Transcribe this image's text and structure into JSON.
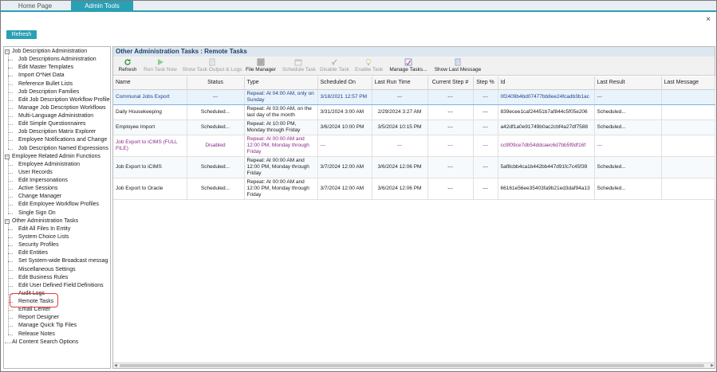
{
  "tabs": {
    "home": "Home Page",
    "admin": "Admin Tools"
  },
  "close_glyph": "×",
  "refresh_button": "Refresh",
  "sidebar": {
    "groups": [
      {
        "label": "Job Description Administration",
        "items": [
          "Job Descriptions Administration",
          "Edit Master Templates",
          "Import O*Net Data",
          "Reference Bullet Lists",
          "Job Description Families",
          "Edit Job Description Workflow Profile",
          "Manage Job Description Workflows",
          "Multi-Language Administration",
          "Edit Simple Questionnaires",
          "Job Description Matrix Explorer",
          "Employee Notifications and Change",
          "Job Description Named Expressions"
        ]
      },
      {
        "label": "Employee Related Admin Functions",
        "items": [
          "Employee Administration",
          "User Records",
          "Edit Impersonations",
          "Active Sessions",
          "Change Manager",
          "Edit Employee Workflow Profiles",
          "Single Sign On"
        ]
      },
      {
        "label": "Other Administration Tasks",
        "items": [
          "Edit All Files In Entity",
          "System Choice Lists",
          "Security Profiles",
          "Edit Entities",
          "Set System-wide Broadcast messag",
          "Miscellaneous Settings",
          "Edit Business Rules",
          "Edit User Defined Field Definitions",
          "Audit Logs",
          "Remote Tasks",
          "Email Center",
          "Report Designer",
          "Manage Quick Tip Files",
          "Release Notes"
        ]
      }
    ],
    "last_item": "AI Content Search Options"
  },
  "panel_title": "Other Administration Tasks : Remote Tasks",
  "toolbar": [
    {
      "label": "Refresh",
      "icon": "refresh-icon",
      "enabled": true
    },
    {
      "label": "Run Task Now",
      "icon": "play-icon",
      "enabled": false
    },
    {
      "label": "Show Task Output & Logs",
      "icon": "document-icon",
      "enabled": false
    },
    {
      "label": "File Manager",
      "icon": "file-manager-icon",
      "enabled": true
    },
    {
      "label": "Schedule Task",
      "icon": "calendar-icon",
      "enabled": false
    },
    {
      "label": "Disable Task",
      "icon": "disable-icon",
      "enabled": false
    },
    {
      "label": "Enable Task",
      "icon": "bulb-icon",
      "enabled": false
    },
    {
      "label": "Manage Tasks...",
      "icon": "manage-tasks-icon",
      "enabled": true
    },
    {
      "label": "Show Last Message",
      "icon": "message-icon",
      "enabled": true
    }
  ],
  "columns": [
    "Name",
    "Status",
    "Type",
    "Scheduled On",
    "Last Run Time",
    "Current Step #",
    "Step %",
    "Id",
    "Last Result",
    "Last Message"
  ],
  "rows": [
    {
      "name": "Communal Jobs Export",
      "status": "---",
      "type": "Repeat: At 04:00 AM, only on Sunday",
      "scheduled_on": "3/18/2021 12:57 PM",
      "last_run": "---",
      "step": "---",
      "pct": "---",
      "id": "0f2409b4bd07477bb8ee24fcadb3b1ac",
      "result": "---",
      "message": ""
    },
    {
      "name": "Daily Housekeeping",
      "status": "Scheduled...",
      "type": "Repeat: At 03:00 AM, on the last day of the month",
      "scheduled_on": "3/31/2024 3:00 AM",
      "last_run": "2/29/2024 3:27 AM",
      "step": "---",
      "pct": "---",
      "id": "839ecee1caf24451b7af844c5f05e206",
      "result": "Scheduled...",
      "message": ""
    },
    {
      "name": "Employee Import",
      "status": "Scheduled...",
      "type": "Repeat: At 10:00 PM, Monday through Friday",
      "scheduled_on": "3/6/2024 10:00 PM",
      "last_run": "3/5/2024 10:15 PM",
      "step": "---",
      "pct": "---",
      "id": "a42df1a0e91749b0ac2cbf4a27df7588",
      "result": "Scheduled...",
      "message": ""
    },
    {
      "name": "Job Export to iCIMS (FULL FILE)",
      "status": "Disabled",
      "type": "Repeat: At 00:00 AM and 12:00 PM, Monday through Friday",
      "scheduled_on": "---",
      "last_run": "---",
      "step": "---",
      "pct": "---",
      "id": "cc9f09ce7db54ddcaec6d7bb5f9df16f",
      "result": "---",
      "message": ""
    },
    {
      "name": "Job Export to iCIMS",
      "status": "Scheduled...",
      "type": "Repeat: At 00:00 AM and 12:00 PM, Monday through Friday",
      "scheduled_on": "3/7/2024 12:00 AM",
      "last_run": "3/6/2024 12:06 PM",
      "step": "---",
      "pct": "---",
      "id": "5af8cbb4ca1b442bb447d91fc7c45f39",
      "result": "Scheduled...",
      "message": ""
    },
    {
      "name": "Job Export to Oracle",
      "status": "Scheduled...",
      "type": "Repeat: At 00:00 AM and 12:00 PM, Monday through Friday",
      "scheduled_on": "3/7/2024 12:00 AM",
      "last_run": "3/6/2024 12:06 PM",
      "step": "---",
      "pct": "---",
      "id": "66161e56ee35403fa9b21ed3daf94a13",
      "result": "Scheduled...",
      "message": ""
    }
  ]
}
